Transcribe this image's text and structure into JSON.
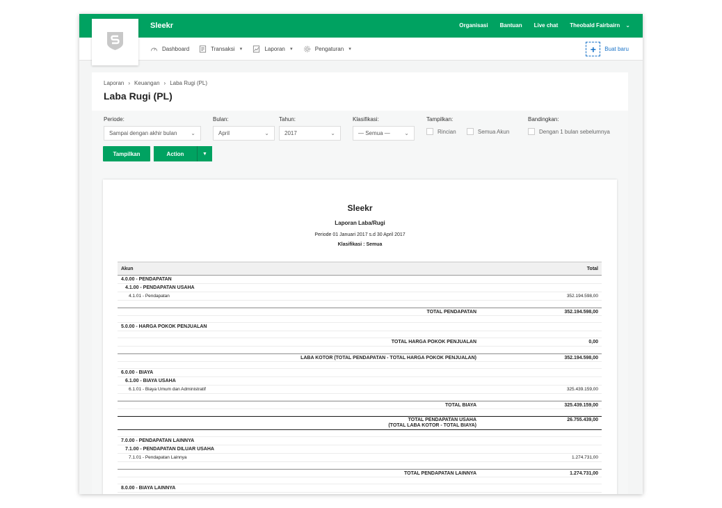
{
  "app": {
    "name": "Sleekr"
  },
  "topnav": {
    "items": [
      "Organisasi",
      "Bantuan",
      "Live chat"
    ],
    "user": "Theobald Fairbairn"
  },
  "menu": [
    {
      "label": "Dashboard",
      "icon": "dashboard-icon",
      "dropdown": false
    },
    {
      "label": "Transaksi",
      "icon": "transaction-icon",
      "dropdown": true
    },
    {
      "label": "Laporan",
      "icon": "report-icon",
      "dropdown": true
    },
    {
      "label": "Pengaturan",
      "icon": "gear-icon",
      "dropdown": true
    }
  ],
  "create_button": "Buat baru",
  "breadcrumb": [
    "Laporan",
    "Keuangan",
    "Laba Rugi (PL)"
  ],
  "page_title": "Laba Rugi (PL)",
  "filters": {
    "periode": {
      "label": "Periode:",
      "value": "Sampai dengan akhir bulan"
    },
    "bulan": {
      "label": "Bulan:",
      "value": "April"
    },
    "tahun": {
      "label": "Tahun:",
      "value": "2017"
    },
    "klasifikasi": {
      "label": "Klasifikasi:",
      "value": "— Semua —"
    },
    "tampilkan": {
      "label": "Tampilkan:",
      "options": [
        "Rincian",
        "Semua Akun"
      ]
    },
    "bandingkan": {
      "label": "Bandingkan:",
      "option": "Dengan 1 bulan sebelumnya"
    }
  },
  "buttons": {
    "show": "Tampilkan",
    "action": "Action"
  },
  "report": {
    "company": "Sleekr",
    "name": "Laporan Laba/Rugi",
    "period": "Periode 01 Januari 2017 s.d 30 April 2017",
    "classification": "Klasifikasi : Semua",
    "col_account": "Akun",
    "col_total": "Total",
    "rows": {
      "r1": "4.0.00 - PENDAPATAN",
      "r2": "4.1.00 - PENDAPATAN USAHA",
      "r3": "4.1.01 - Pendapatan",
      "r3_amt": "352.194.598,00",
      "t1": "TOTAL PENDAPATAN",
      "t1_amt": "352.194.598,00",
      "r4": "5.0.00 - HARGA POKOK PENJUALAN",
      "t2": "TOTAL HARGA POKOK PENJUALAN",
      "t2_amt": "0,00",
      "t3": "LABA KOTOR (TOTAL PENDAPATAN - TOTAL HARGA POKOK PENJUALAN)",
      "t3_amt": "352.194.598,00",
      "r5": "6.0.00 - BIAYA",
      "r6": "6.1.00 - BIAYA USAHA",
      "r7": "6.1.01 - Biaya Umum dan Administratif",
      "r7_amt": "325.439.159,00",
      "t4": "TOTAL BIAYA",
      "t4_amt": "325.439.159,00",
      "t5a": "TOTAL PENDAPATAN USAHA",
      "t5b": "(TOTAL LABA KOTOR - TOTAL BIAYA)",
      "t5_amt": "26.755.439,00",
      "r8": "7.0.00 - PENDAPATAN LAINNYA",
      "r9": "7.1.00 - PENDAPATAN DILUAR USAHA",
      "r10": "7.1.01 - Pendapatan Lainnya",
      "r10_amt": "1.274.731,00",
      "t6": "TOTAL PENDAPATAN LAINNYA",
      "t6_amt": "1.274.731,00",
      "r11": "8.0.00 - BIAYA LAINNYA"
    }
  },
  "colors": {
    "brand": "#00a261",
    "link": "#1a73c8"
  }
}
